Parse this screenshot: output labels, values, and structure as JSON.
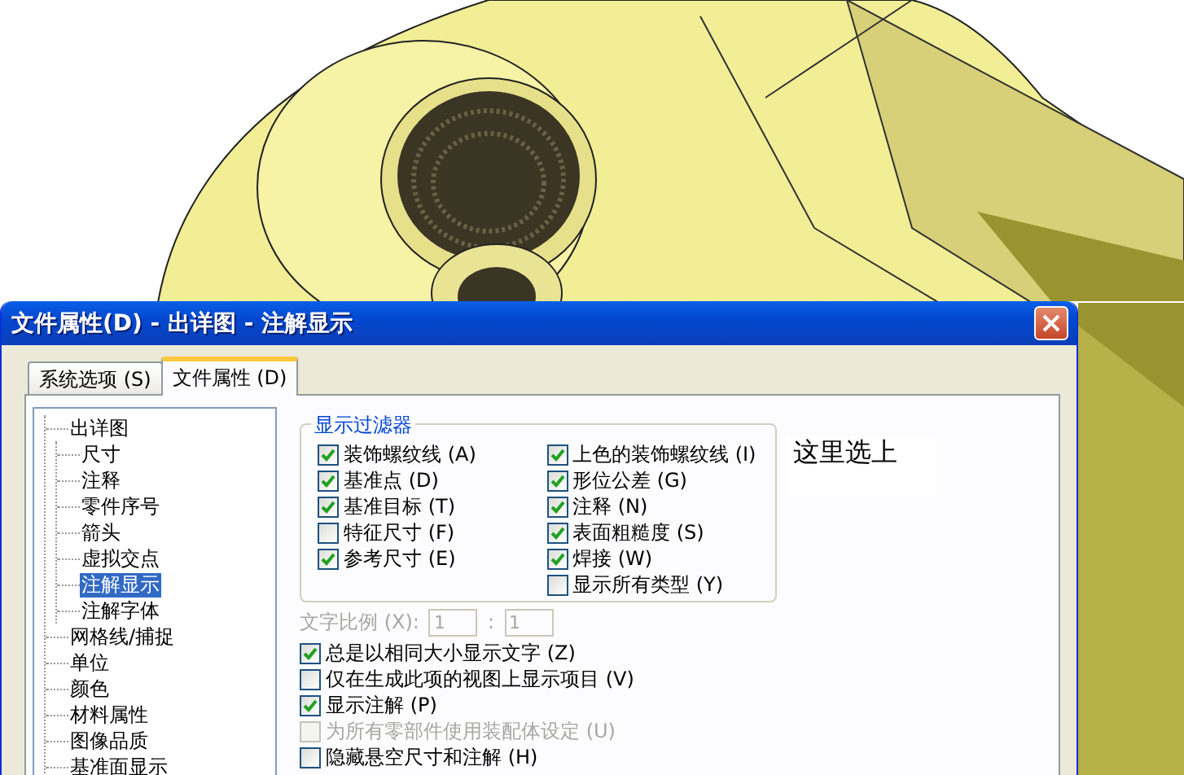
{
  "window": {
    "title": "文件属性(D) - 出详图 - 注解显示"
  },
  "tabs": [
    {
      "label": "系统选项 (S)",
      "selected": false
    },
    {
      "label": "文件属性 (D)",
      "selected": true
    }
  ],
  "tree": [
    {
      "label": "出详图",
      "selected": false,
      "children": [
        {
          "label": "尺寸",
          "selected": false
        },
        {
          "label": "注释",
          "selected": false
        },
        {
          "label": "零件序号",
          "selected": false
        },
        {
          "label": "箭头",
          "selected": false
        },
        {
          "label": "虚拟交点",
          "selected": false
        },
        {
          "label": "注解显示",
          "selected": true
        },
        {
          "label": "注解字体",
          "selected": false
        }
      ]
    },
    {
      "label": "网格线/捕捉",
      "selected": false
    },
    {
      "label": "单位",
      "selected": false
    },
    {
      "label": "颜色",
      "selected": false
    },
    {
      "label": "材料属性",
      "selected": false
    },
    {
      "label": "图像品质",
      "selected": false
    },
    {
      "label": "基准面显示",
      "selected": false
    }
  ],
  "display_filter": {
    "title": "显示过滤器",
    "columns": [
      [
        {
          "label": "装饰螺纹线 (A)",
          "checked": true
        },
        {
          "label": "基准点 (D)",
          "checked": true
        },
        {
          "label": "基准目标 (T)",
          "checked": true
        },
        {
          "label": "特征尺寸 (F)",
          "checked": false
        },
        {
          "label": "参考尺寸 (E)",
          "checked": true
        }
      ],
      [
        {
          "label": "上色的装饰螺纹线 (I)",
          "checked": true
        },
        {
          "label": "形位公差 (G)",
          "checked": true
        },
        {
          "label": "注释 (N)",
          "checked": true
        },
        {
          "label": "表面粗糙度 (S)",
          "checked": true
        },
        {
          "label": "焊接 (W)",
          "checked": true
        },
        {
          "label": "显示所有类型 (Y)",
          "checked": false
        }
      ]
    ]
  },
  "text_scale": {
    "label": "文字比例 (X):",
    "disabled": true,
    "value_1": "1",
    "separator": ":",
    "value_2": "1"
  },
  "options": [
    {
      "label": "总是以相同大小显示文字 (Z)",
      "checked": true,
      "disabled": false
    },
    {
      "label": "仅在生成此项的视图上显示项目 (V)",
      "checked": false,
      "disabled": false
    },
    {
      "label": "显示注解 (P)",
      "checked": true,
      "disabled": false
    },
    {
      "label": "为所有零部件使用装配体设定 (U)",
      "checked": false,
      "disabled": true
    },
    {
      "label": "隐藏悬空尺寸和注解 (H)",
      "checked": false,
      "disabled": false
    }
  ],
  "note": {
    "text": "这里选上"
  }
}
